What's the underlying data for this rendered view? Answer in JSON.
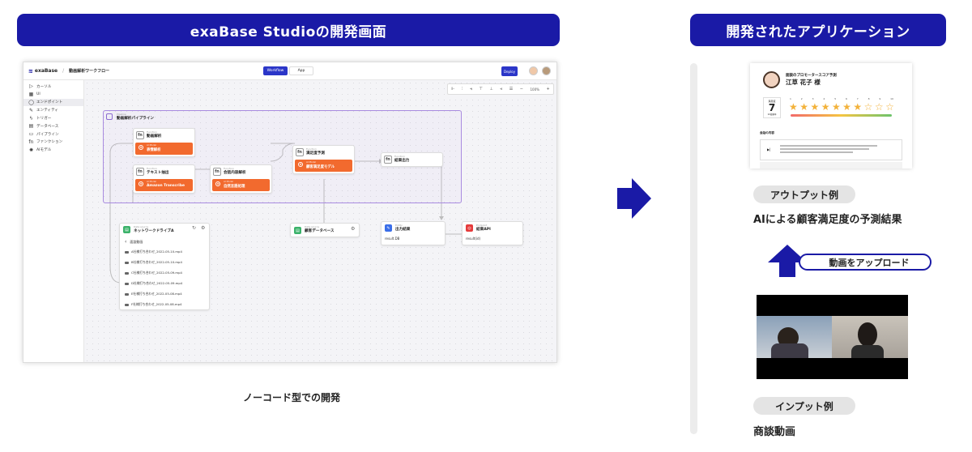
{
  "left_heading": "exaBase Studioの開発画面",
  "right_heading": "開発されたアプリケーション",
  "caption_nocode": "ノーコード型での開発",
  "app": {
    "logo": "exaBase",
    "breadcrumb_sep": "/",
    "project_title": "動画解析ワークフロー",
    "tabs": [
      "Workflow",
      "App"
    ],
    "deploy_label": "Deploy",
    "zoom": "100%",
    "sidebar": [
      {
        "icon": "cursor-icon",
        "glyph": "▷",
        "label": "カーソル"
      },
      {
        "icon": "grid-icon",
        "glyph": "▦",
        "label": "UI"
      },
      {
        "icon": "endpoint-icon",
        "glyph": "◯",
        "label": "エンドポイント",
        "active": true
      },
      {
        "icon": "entity-icon",
        "glyph": "✎",
        "label": "エンティティ"
      },
      {
        "icon": "trigger-icon",
        "glyph": "ϟ",
        "label": "トリガー"
      },
      {
        "icon": "database-icon",
        "glyph": "▤",
        "label": "データベース"
      },
      {
        "icon": "pipeline-icon",
        "glyph": "▭",
        "label": "パイプライン"
      },
      {
        "icon": "function-icon",
        "glyph": "fn",
        "label": "ファンクション"
      },
      {
        "icon": "ai-model-icon",
        "glyph": "✺",
        "label": "AIモデル"
      }
    ],
    "pipeline": {
      "sub": "Pipeline",
      "title": "動画解析パイプライン"
    },
    "nodes": {
      "video": {
        "sub": "Function",
        "title": "動画解析",
        "bar_sub": "AI Model",
        "bar": "表情解析"
      },
      "text": {
        "sub": "Function",
        "title": "テキスト抽出",
        "bar_sub": "AI Model",
        "bar": "Amazon Transcribe"
      },
      "conv": {
        "sub": "Function",
        "title": "会話内容解析",
        "bar_sub": "AI Model",
        "bar": "自然言語処理"
      },
      "pred": {
        "sub": "Function",
        "title": "満足度予測",
        "bar_sub": "AI Model",
        "bar": "顧客満足度モデル"
      },
      "out": {
        "sub": "Function",
        "title": "結果出力"
      },
      "drive": {
        "sub": "Data source",
        "title": "ネットワークドライブA",
        "back": "面談動画",
        "files": [
          "A社様打ち合わせ_2022-05-10.mp4",
          "B社様打ち合わせ_2022-05-10.mp4",
          "C社様打ち合わせ_2022-05-09.mp4",
          "D社様打ち合わせ_2022-05-09.mp4",
          "E社様打ち合わせ_2022-05-08.mp4",
          "F社様打ち合わせ_2022-05-08.mp4"
        ]
      },
      "customer_db": {
        "sub": "Data source",
        "title": "顧客データベース"
      },
      "result": {
        "sub": "Entity",
        "title": "出力結果",
        "field": "result.DB"
      },
      "api": {
        "sub": "Endpoint",
        "title": "結果API",
        "field": "result(id)"
      }
    }
  },
  "output": {
    "doc_title": "面談のプロモータースコア予測",
    "customer": "江草 花子 様",
    "score_label": "満足度",
    "score": "7",
    "score_caption": "10段階中",
    "rating": {
      "value": 7,
      "max": 10
    },
    "scale_numbers": [
      "1",
      "2",
      "3",
      "4",
      "5",
      "6",
      "7",
      "8",
      "9",
      "10"
    ],
    "section": "会話の内容",
    "play_glyph": "▶|",
    "colors": {
      "star": "#f3b23a",
      "bar_start": "#f26a6a",
      "bar_mid": "#f5c542",
      "bar_end": "#6cc36c"
    }
  },
  "label_output": "アウトプット例",
  "desc_output": "AIによる顧客満足度の予測結果",
  "upload_label": "動画をアップロード",
  "label_input": "インプット例",
  "desc_input": "商談動画"
}
